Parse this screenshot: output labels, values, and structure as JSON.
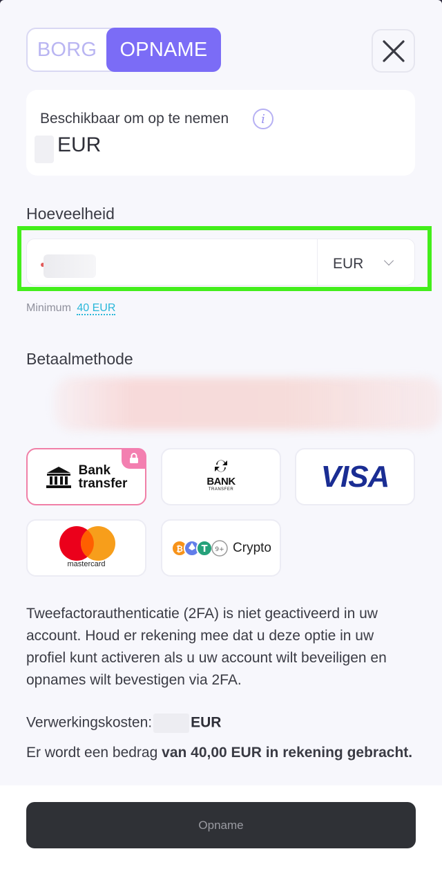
{
  "toggle": {
    "borg": "BORG",
    "opname": "OPNAME"
  },
  "balance": {
    "label": "Beschikbaar om op te nemen",
    "currency": "EUR"
  },
  "amount": {
    "label": "Hoeveelheid",
    "currency": "EUR",
    "minimum_label": "Minimum",
    "minimum_value": "40 EUR"
  },
  "payment": {
    "label": "Betaalmethode",
    "methods": [
      {
        "name": "Bank transfer",
        "line1": "Bank",
        "line2": "transfer",
        "selected": true,
        "locked": true
      },
      {
        "name": "BANK TRANSFER",
        "line1": "BANK",
        "line2": "TRANSFER"
      },
      {
        "name": "VISA"
      },
      {
        "name": "mastercard"
      },
      {
        "name": "Crypto"
      }
    ]
  },
  "notice": "Tweefactorauthenticatie (2FA) is niet geactiveerd in uw account. Houd er rekening mee dat u deze optie in uw profiel kunt activeren als u uw account wilt beveiligen en opnames wilt bevestigen via 2FA.",
  "fees": {
    "label": "Verwerkingskosten:",
    "currency": "EUR"
  },
  "charge": {
    "prefix": "Er wordt een bedrag",
    "bold": "van 40,00 EUR in rekening gebracht."
  },
  "submit_label": "Opname",
  "colors": {
    "accent": "#7b6cf6",
    "highlight": "#43ee1b",
    "selected_border": "#f07fa7",
    "visa": "#1a2d93",
    "button": "#2f3136"
  },
  "icons": [
    "close-icon",
    "info-icon",
    "lock-icon",
    "bank-building-icon",
    "bank-transfer-arrows-icon",
    "mastercard-logo",
    "crypto-coins-icon",
    "chevron-down-icon"
  ]
}
